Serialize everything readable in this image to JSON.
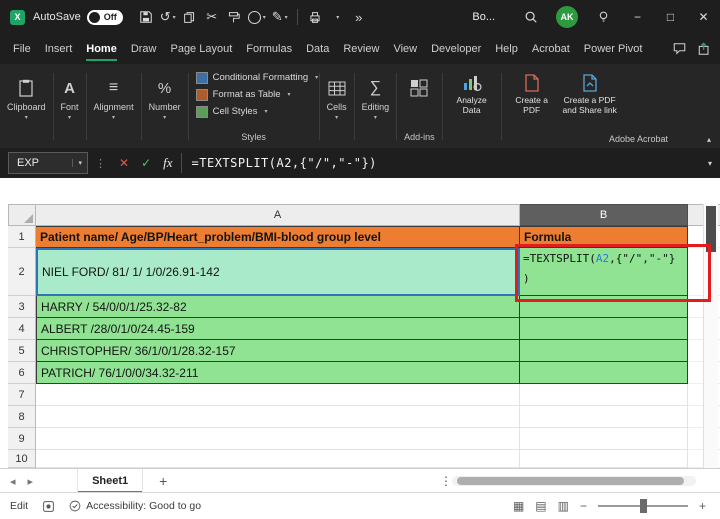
{
  "colors": {
    "accent_green": "#21A366",
    "header_orange": "#ED7D31",
    "cell_green": "#8FE393",
    "cell_green_referenced": "#A9EACA",
    "reference_blue": "#2F7BD9",
    "annotation_red": "#E11D1D",
    "titlebar_dark": "#1E1E1E",
    "ribbon_dark": "#262626"
  },
  "icons": {
    "undo": "↺",
    "cut": "✂",
    "pen": "✎",
    "overflow": "»",
    "dots": "⋮",
    "cancel": "✕",
    "enter": "✓",
    "caret": "▾",
    "collapse": "▴",
    "nav_left": "◂",
    "nav_right": "▸",
    "add_sheet": "+",
    "minus": "−",
    "plus": "+",
    "view_normal": "▦",
    "view_layout": "▤",
    "view_break": "▥",
    "align": "≡",
    "font": "A",
    "percent": "%",
    "sigma": "∑",
    "minimize": "−",
    "maximize": "□",
    "close": "✕",
    "logo": "X"
  },
  "title_bar": {
    "autosave_label": "AutoSave",
    "autosave_state": "Off",
    "workbook_title": "Bo...",
    "avatar_initials": "AK"
  },
  "menu": {
    "tabs": [
      "File",
      "Insert",
      "Home",
      "Draw",
      "Page Layout",
      "Formulas",
      "Data",
      "Review",
      "View",
      "Developer",
      "Help",
      "Acrobat",
      "Power Pivot"
    ],
    "active_tab": "Home"
  },
  "ribbon": {
    "groups": {
      "clipboard": "Clipboard",
      "font": "Font",
      "alignment": "Alignment",
      "number": "Number",
      "styles": "Styles",
      "cells": "Cells",
      "editing": "Editing",
      "addins": "Add-ins",
      "analyze": "Analyze Data",
      "create_pdf": "Create a PDF",
      "create_share": "Create a PDF and Share link",
      "acrobat": "Adobe Acrobat"
    },
    "styles_items": [
      "Conditional Formatting",
      "Format as Table",
      "Cell Styles"
    ]
  },
  "formula_bar": {
    "name_box": "EXP",
    "fx": "fx",
    "formula": "=TEXTSPLIT(A2,{\"/\",\"-\"})"
  },
  "grid": {
    "col_headers": [
      "A",
      "B"
    ],
    "row_numbers": [
      "1",
      "2",
      "3",
      "4",
      "5",
      "6",
      "7",
      "8",
      "9",
      "10"
    ],
    "cells": {
      "A1": "Patient name/ Age/BP/Heart_problem/BMI-blood group level",
      "B1": "Formula",
      "A2": "NIEL FORD/ 81/ 1/ 1/0/26.91-142",
      "A3": "HARRY / 54/0/0/1/25.32-82",
      "A4": "ALBERT /28/0/1/0/24.45-159",
      "A5": "CHRISTOPHER/ 36/1/0/1/28.32-157",
      "A6": "PATRICH/ 76/1/0/0/34.32-211"
    },
    "b2_formula": {
      "p1": "=TEXTSPLIT(",
      "ref": "A2",
      "p2": ",{\"/\",\"-\"}",
      "p3": ")"
    }
  },
  "sheet_bar": {
    "tab": "Sheet1"
  },
  "status_bar": {
    "mode": "Edit",
    "accessibility": "Accessibility: Good to go"
  }
}
